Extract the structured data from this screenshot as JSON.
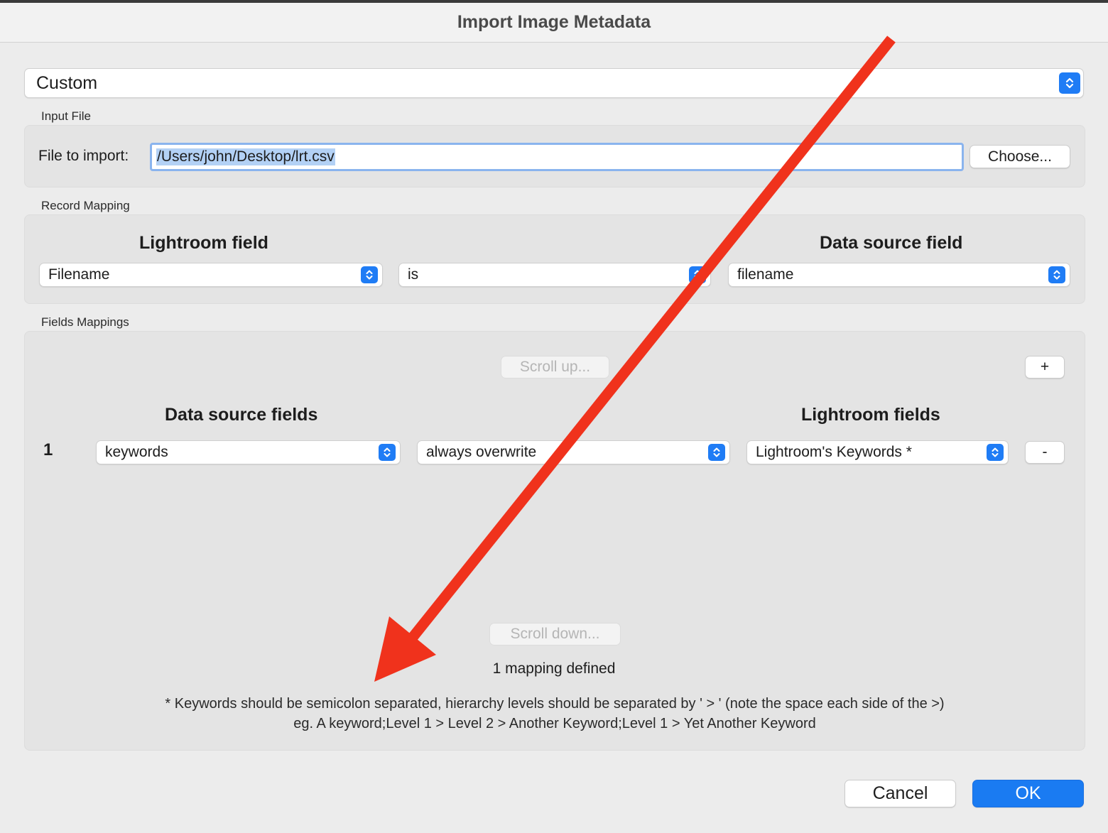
{
  "dialog": {
    "title": "Import Image Metadata"
  },
  "preset": {
    "value": "Custom",
    "icon": "updown-stepper-icon"
  },
  "input_file": {
    "section_label": "Input File",
    "field_label": "File to import:",
    "path": "/Users/john/Desktop/lrt.csv",
    "choose_label": "Choose..."
  },
  "record_mapping": {
    "section_label": "Record Mapping",
    "lightroom_field_heading": "Lightroom field",
    "data_source_field_heading": "Data source field",
    "lightroom_field_value": "Filename",
    "operator_value": "is",
    "data_source_field_value": "filename"
  },
  "fields_mappings": {
    "section_label": "Fields Mappings",
    "scroll_up_label": "Scroll up...",
    "add_label": "+",
    "data_source_fields_heading": "Data source fields",
    "lightroom_fields_heading": "Lightroom fields",
    "rows": [
      {
        "index": "1",
        "data_source": "keywords",
        "mode": "always overwrite",
        "lightroom_field": "Lightroom's Keywords *",
        "remove_label": "-"
      }
    ],
    "scroll_down_label": "Scroll down...",
    "count_text": "1 mapping defined",
    "note_line1": "* Keywords should be semicolon separated, hierarchy levels should be separated by ' > ' (note the space each side of the >)",
    "note_line2": "eg. A keyword;Level 1 > Level 2 > Another Keyword;Level 1 > Yet Another Keyword"
  },
  "footer": {
    "cancel_label": "Cancel",
    "ok_label": "OK"
  },
  "colors": {
    "accent": "#1a7bf2",
    "annotation_arrow": "#f0321c"
  }
}
